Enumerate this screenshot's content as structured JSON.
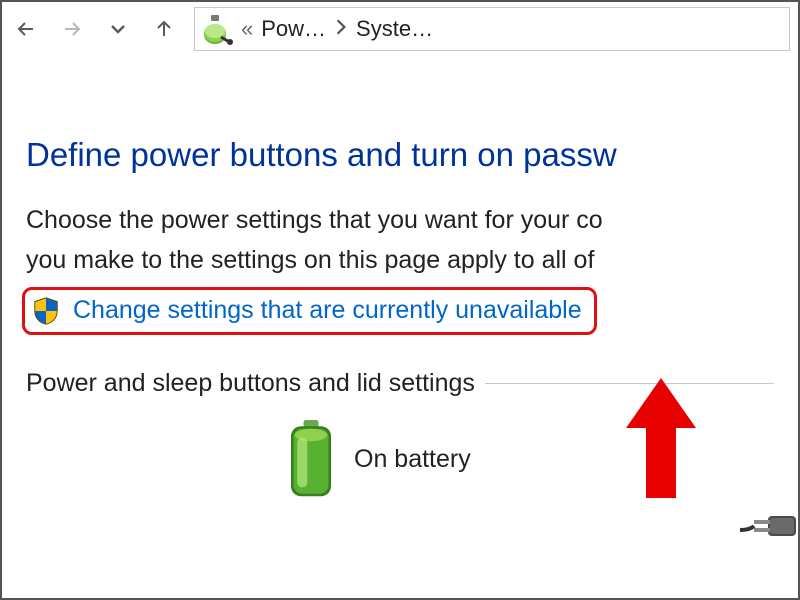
{
  "nav": {
    "breadcrumb1": "Pow…",
    "breadcrumb2": "Syste…",
    "chevrons": "«"
  },
  "page": {
    "title": "Define power buttons and turn on passw",
    "desc_line1": "Choose the power settings that you want for your co",
    "desc_line2": "you make to the settings on this page apply to all of"
  },
  "link": {
    "change_unavailable": "Change settings that are currently unavailable"
  },
  "section": {
    "label": "Power and sleep buttons and lid settings",
    "on_battery": "On battery"
  }
}
